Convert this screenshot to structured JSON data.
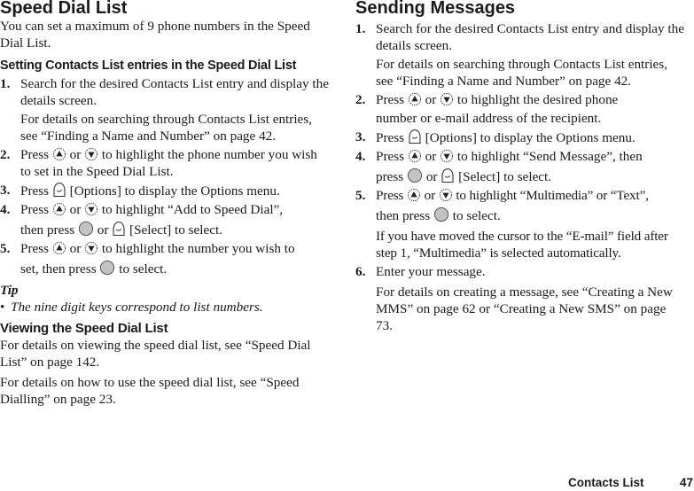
{
  "left": {
    "title": "Speed Dial List",
    "intro": "You can set a maximum of 9 phone numbers in the Speed Dial List.",
    "subheading": "Setting Contacts List entries in the Speed Dial List",
    "steps": [
      {
        "num": "1.",
        "text": "Search for the desired Contacts List entry and display the details screen.",
        "note": "For details on searching through Contacts List entries, see “Finding a Name and Number” on page 42."
      },
      {
        "num": "2.",
        "pre": "Press",
        "mid": "or",
        "post": "to highlight the phone number you wish to set in the Speed Dial List."
      },
      {
        "num": "3.",
        "pre": "Press",
        "post": "[Options] to display the Options menu."
      },
      {
        "num": "4.",
        "pre": "Press",
        "mid": "or",
        "post": "to highlight “Add to Speed Dial”,",
        "line2_pre": "then press",
        "line2_mid": "or",
        "line2_post": "[Select] to select."
      },
      {
        "num": "5.",
        "pre": "Press",
        "mid": "or",
        "post": "to highlight the number you wish to",
        "line2_pre": "set, then press",
        "line2_post": "to select."
      }
    ],
    "tip": {
      "heading": "Tip",
      "bullet": "•",
      "text": "The nine digit keys correspond to list numbers."
    },
    "viewing": {
      "heading": "Viewing the Speed Dial List",
      "para1": "For details on viewing the speed dial list, see “Speed Dial List” on page 142.",
      "para2": "For details on how to use the speed dial list, see “Speed Dialling” on page 23."
    }
  },
  "right": {
    "title": "Sending Messages",
    "steps": [
      {
        "num": "1.",
        "text": "Search for the desired Contacts List entry and display the details screen.",
        "note": "For details on searching through Contacts List entries, see “Finding a Name and Number” on page 42."
      },
      {
        "num": "2.",
        "pre": "Press",
        "mid": "or",
        "post": "to highlight the desired phone",
        "line2": "number or e-mail address of the recipient."
      },
      {
        "num": "3.",
        "pre": "Press",
        "post": "[Options] to display the Options menu."
      },
      {
        "num": "4.",
        "pre": "Press",
        "mid": "or",
        "post": "to highlight “Send Message”, then",
        "line2_pre": "press",
        "line2_mid": "or",
        "line2_post": "[Select] to select."
      },
      {
        "num": "5.",
        "pre": "Press",
        "mid": "or",
        "post": "to highlight “Multimedia” or “Text”,",
        "line2_pre": "then press",
        "line2_post": "to select.",
        "note": "If you have moved the cursor to the “E-mail” field after step 1, “Multimedia” is selected automatically."
      },
      {
        "num": "6.",
        "text": "Enter your message.",
        "note": "For details on creating a message, see “Creating a New MMS” on page 62 or “Creating a New SMS” on page 73."
      }
    ]
  },
  "footer": {
    "section": "Contacts List",
    "page": "47"
  },
  "icons": {
    "nav_up": "nav-up-key-icon",
    "nav_down": "nav-down-key-icon",
    "center": "center-key-icon",
    "softkey": "left-soft-key-icon"
  }
}
